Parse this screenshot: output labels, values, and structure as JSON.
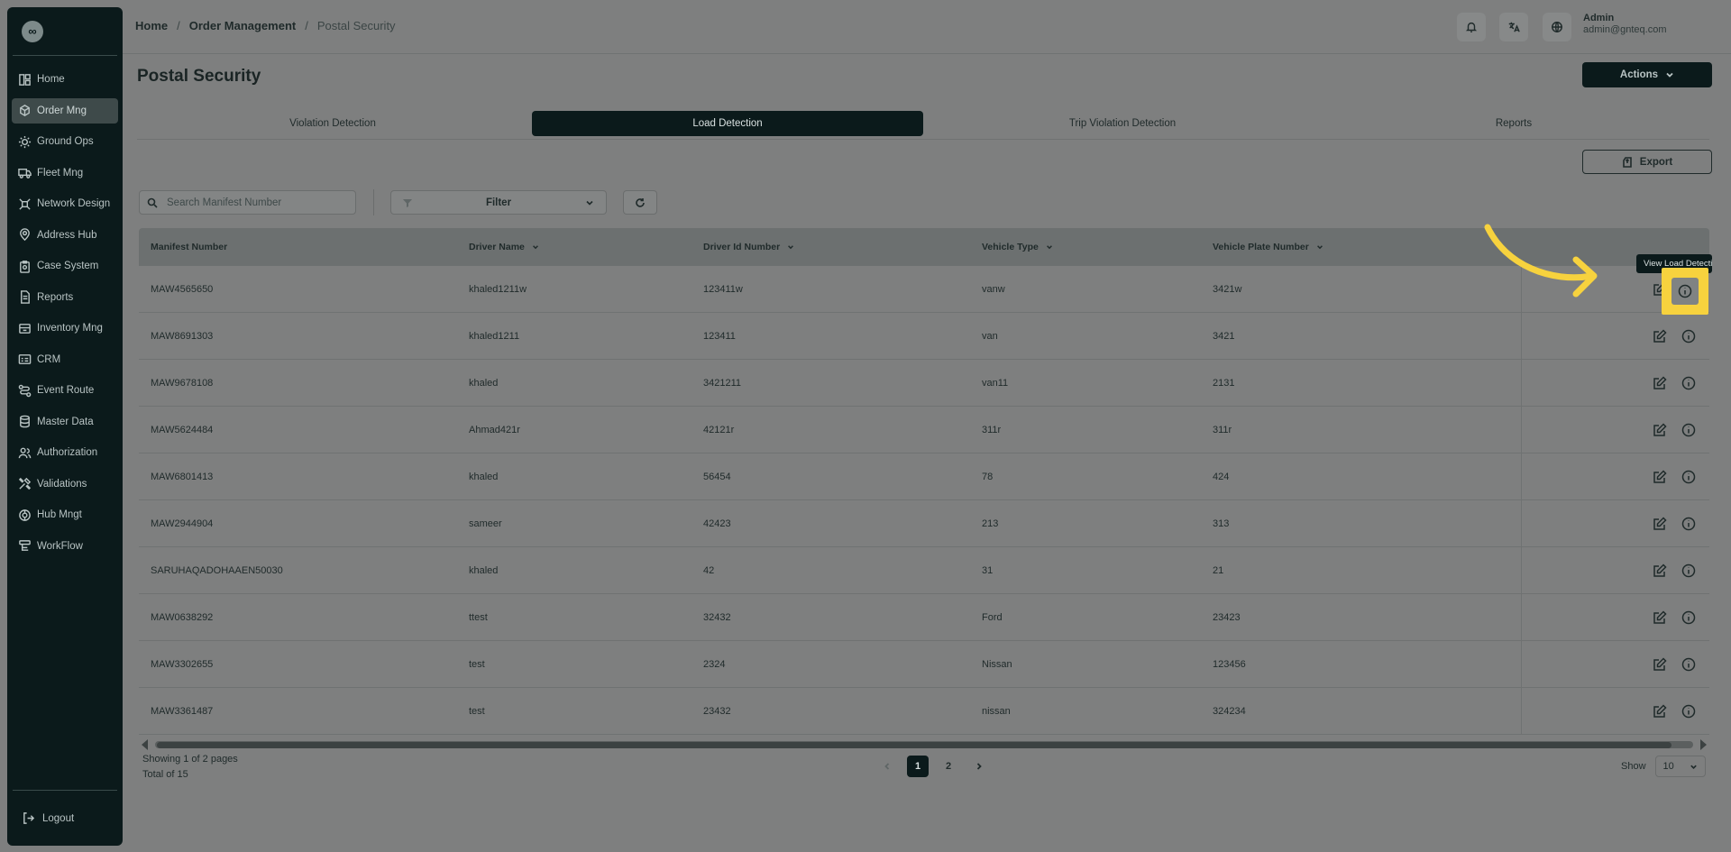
{
  "app": {
    "logo_glyph": "∞"
  },
  "sidebar": {
    "items": [
      {
        "label": "Home",
        "icon": "layout-icon"
      },
      {
        "label": "Order Mng",
        "icon": "package-icon",
        "active": true
      },
      {
        "label": "Ground Ops",
        "icon": "sun-icon"
      },
      {
        "label": "Fleet Mng",
        "icon": "truck-icon"
      },
      {
        "label": "Network Design",
        "icon": "network-icon"
      },
      {
        "label": "Address Hub",
        "icon": "location-icon"
      },
      {
        "label": "Case System",
        "icon": "clipboard-icon"
      },
      {
        "label": "Reports",
        "icon": "document-icon"
      },
      {
        "label": "Inventory Mng",
        "icon": "inventory-icon"
      },
      {
        "label": "CRM",
        "icon": "crm-icon"
      },
      {
        "label": "Event Route",
        "icon": "route-icon"
      },
      {
        "label": "Master Data",
        "icon": "database-icon"
      },
      {
        "label": "Authorization",
        "icon": "users-icon"
      },
      {
        "label": "Validations",
        "icon": "tools-icon"
      },
      {
        "label": "Hub Mngt",
        "icon": "hub-icon"
      },
      {
        "label": "WorkFlow",
        "icon": "workflow-icon"
      }
    ],
    "logout_label": "Logout"
  },
  "breadcrumb": {
    "home": "Home",
    "section": "Order Management",
    "current": "Postal Security",
    "separator": "/"
  },
  "user": {
    "name": "Admin",
    "email": "admin@gnteq.com"
  },
  "header": {
    "title": "Postal Security",
    "actions_label": "Actions"
  },
  "tabs": [
    "Violation Detection",
    "Load Detection",
    "Trip Violation Detection",
    "Reports"
  ],
  "active_tab": "Load Detection",
  "toolbar": {
    "export_label": "Export",
    "search_placeholder": "Search Manifest Number",
    "filter_label": "Filter"
  },
  "table": {
    "columns": [
      "Manifest Number",
      "Driver Name",
      "Driver Id Number",
      "Vehicle Type",
      "Vehicle Plate Number"
    ],
    "rows": [
      [
        "MAW4565650",
        "khaled1211w",
        "123411w",
        "vanw",
        "3421w"
      ],
      [
        "MAW8691303",
        "khaled1211",
        "123411",
        "van",
        "3421"
      ],
      [
        "MAW9678108",
        "khaled",
        "3421211",
        "van11",
        "2131"
      ],
      [
        "MAW5624484",
        "Ahmad421r",
        "42121r",
        "311r",
        "311r"
      ],
      [
        "MAW6801413",
        "khaled",
        "56454",
        "78",
        "424"
      ],
      [
        "MAW2944904",
        "sameer",
        "42423",
        "213",
        "313"
      ],
      [
        "SARUHAQADOHAAEN50030",
        "khaled",
        "42",
        "31",
        "21"
      ],
      [
        "MAW0638292",
        "ttest",
        "32432",
        "Ford",
        "23423"
      ],
      [
        "MAW3302655",
        "test",
        "2324",
        "Nissan",
        "123456"
      ],
      [
        "MAW3361487",
        "test",
        "23432",
        "nissan",
        "324234"
      ]
    ],
    "tooltip": "View Load Detection"
  },
  "pagination": {
    "showing": "Showing 1 of 2 pages",
    "total": "Total of 15",
    "pages": [
      "1",
      "2"
    ],
    "current_page": "1",
    "show_label": "Show",
    "page_size": "10"
  },
  "colors": {
    "accent_dark": "#0b1a1b",
    "highlight": "#f7d23e",
    "arrow": "#f7d23e"
  }
}
